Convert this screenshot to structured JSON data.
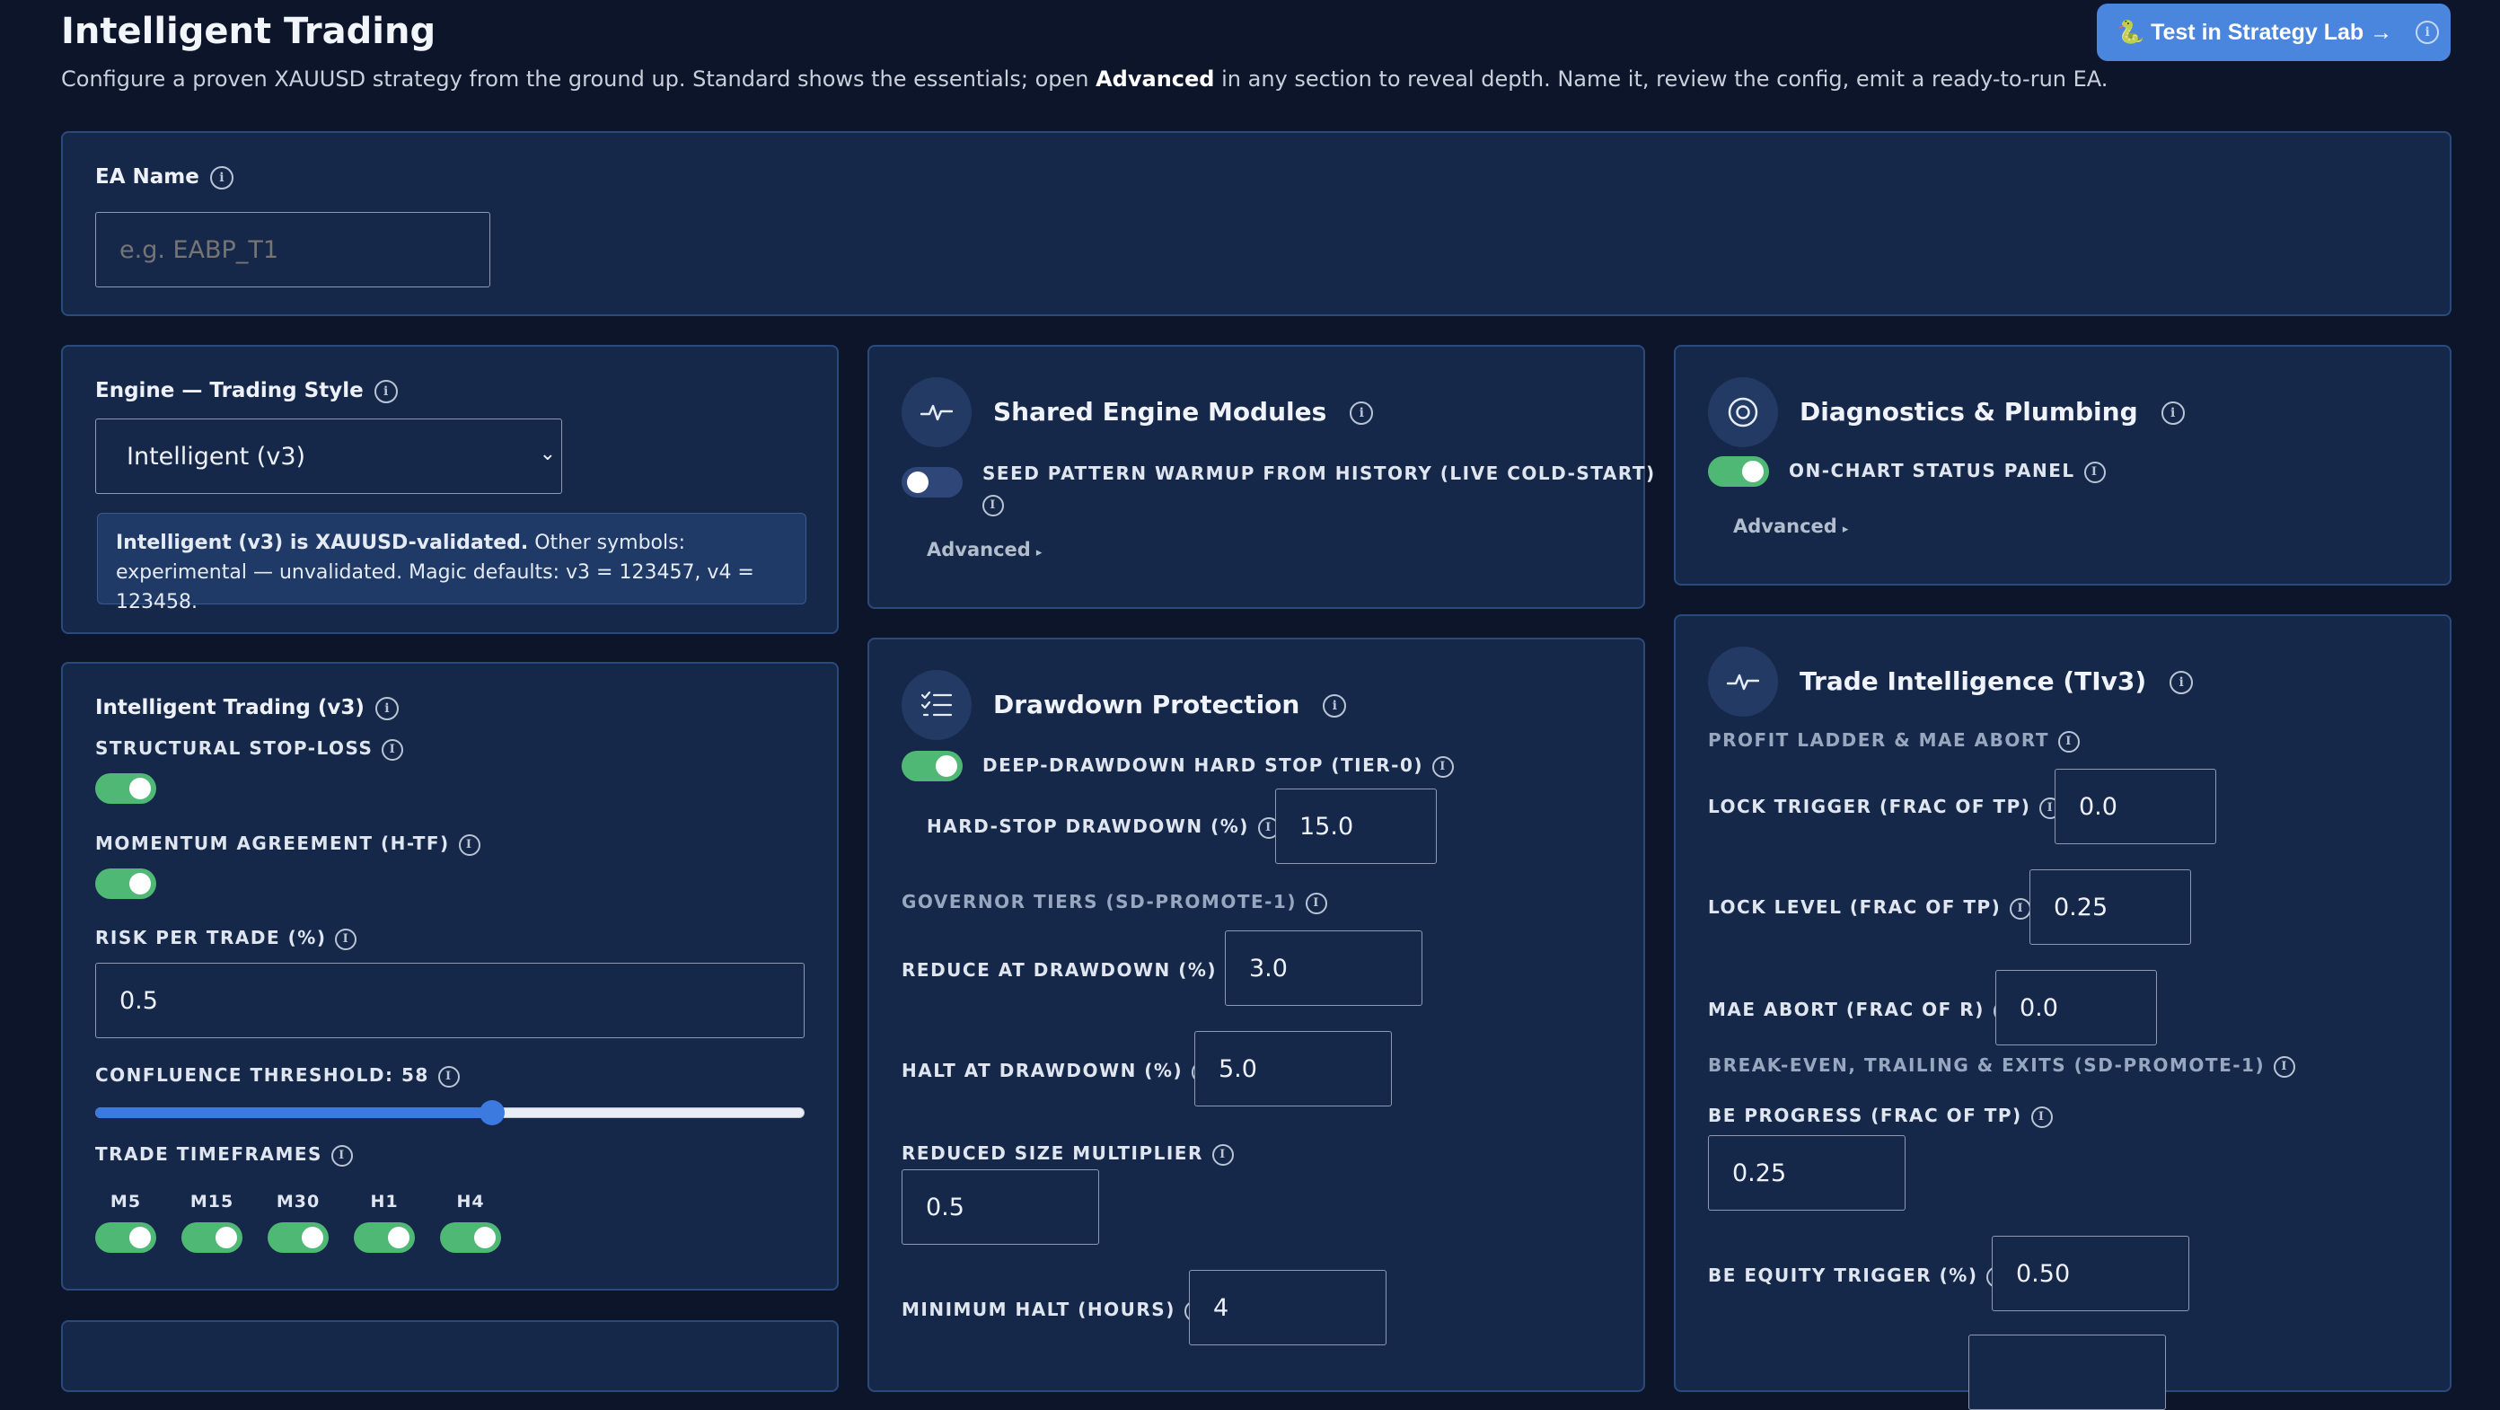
{
  "header": {
    "title": "Intelligent Trading",
    "subtitle_before": "Configure a proven XAUUSD strategy from the ground up. Standard shows the essentials; open ",
    "subtitle_bold": "Advanced",
    "subtitle_after": " in any section to reveal depth. Name it, review the config, emit a ready-to-run EA.",
    "test_button": "🐍 Test in Strategy Lab →"
  },
  "ea_name": {
    "label": "EA Name",
    "placeholder": "e.g. EABP_T1"
  },
  "engine": {
    "label": "Engine — Trading Style",
    "selected": "Intelligent (v3)",
    "note_bold": "Intelligent (v3) is XAUUSD-validated.",
    "note_text": " Other symbols: experimental — unvalidated. Magic defaults: v3 = 123457, v4 = 123458."
  },
  "intelligent": {
    "title": "Intelligent Trading (v3)",
    "structural_stop_loss": {
      "label": "Structural Stop-Loss",
      "on": true
    },
    "momentum_agreement": {
      "label": "Momentum Agreement (H-TF)",
      "on": true
    },
    "risk_label": "Risk per Trade (%)",
    "risk_value": "0.5",
    "confluence_label": "Confluence Threshold: 58",
    "confluence_value": 58,
    "confluence_min": 0,
    "confluence_max": 100,
    "timeframes_label": "Trade Timeframes",
    "timeframes": [
      {
        "label": "M5",
        "on": true
      },
      {
        "label": "M15",
        "on": true
      },
      {
        "label": "M30",
        "on": true
      },
      {
        "label": "H1",
        "on": true
      },
      {
        "label": "H4",
        "on": true
      }
    ]
  },
  "shared": {
    "title": "Shared Engine Modules",
    "seed_label": "Seed Pattern Warmup From History (Live Cold-Start)",
    "seed_on": false,
    "advanced": "Advanced"
  },
  "diagnostics": {
    "title": "Diagnostics & Plumbing",
    "status_label": "On-Chart Status Panel",
    "status_on": true,
    "advanced": "Advanced"
  },
  "drawdown": {
    "title": "Drawdown Protection",
    "hard_stop_label": "Deep-Drawdown Hard Stop (Tier-0)",
    "hard_stop_on": true,
    "hard_stop_dd_label": "Hard-Stop Drawdown (%)",
    "hard_stop_dd_value": "15.0",
    "governor_label": "Governor Tiers (SD-PROMOTE-1)",
    "reduce_label": "Reduce at Drawdown (%)",
    "reduce_value": "3.0",
    "halt_label": "Halt at Drawdown (%)",
    "halt_value": "5.0",
    "reduced_size_label": "Reduced Size Multiplier",
    "reduced_size_value": "0.5",
    "min_halt_label": "Minimum Halt (hours)",
    "min_halt_value": "4"
  },
  "trade_intel": {
    "title": "Trade Intelligence (TIv3)",
    "ladder_label": "Profit Ladder & MAE Abort",
    "lock_trigger_label": "Lock Trigger (frac of TP)",
    "lock_trigger_value": "0.0",
    "lock_level_label": "Lock Level (frac of TP)",
    "lock_level_value": "0.25",
    "mae_label": "MAE Abort (frac of R)",
    "mae_value": "0.0",
    "be_section_label": "Break-Even, Trailing & Exits (SD-PROMOTE-1)",
    "be_progress_label": "BE Progress (frac of TP)",
    "be_progress_value": "0.25",
    "be_equity_label": "BE Equity Trigger (%)",
    "be_equity_value": "0.50"
  }
}
